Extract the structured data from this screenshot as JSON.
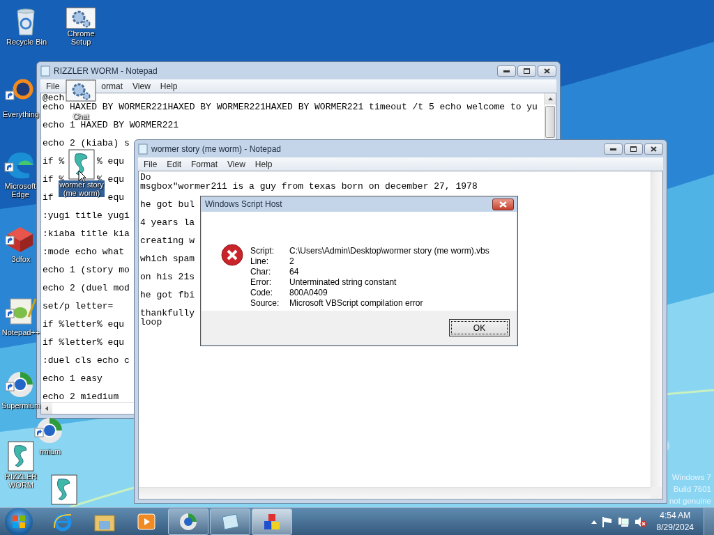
{
  "desktop_icons": [
    {
      "label": "Recycle Bin",
      "kind": "recycle-bin",
      "shortcut": false,
      "selected": false
    },
    {
      "label": "Chrome Setup",
      "kind": "gear",
      "shortcut": false,
      "selected": false
    },
    {
      "label": "Everything",
      "kind": "ring",
      "shortcut": true,
      "selected": false
    },
    {
      "label": "Chat",
      "kind": "gear",
      "shortcut": false,
      "selected": false
    },
    {
      "label": "Microsoft Edge",
      "kind": "edge",
      "shortcut": true,
      "selected": false
    },
    {
      "label": "wormer story (me worm)",
      "kind": "script",
      "shortcut": false,
      "selected": true
    },
    {
      "label": "3dfox",
      "kind": "cube",
      "shortcut": true,
      "selected": false
    },
    {
      "label": "Notepad++",
      "kind": "notepad",
      "shortcut": true,
      "selected": false
    },
    {
      "label": "Supermium",
      "kind": "globe",
      "shortcut": true,
      "selected": false
    },
    {
      "label": "rmium",
      "kind": "globe",
      "shortcut": true,
      "selected": false
    },
    {
      "label": "RIZZLER WORM",
      "kind": "script",
      "shortcut": false,
      "selected": false
    },
    {
      "kind": "script",
      "shortcut": false,
      "selected": false
    }
  ],
  "windows": [
    {
      "title": "RIZZLER WORM - Notepad",
      "menu": [
        "File",
        "ormat",
        "View",
        "Help"
      ],
      "paragraphs": [
        [
          "@ech",
          "echo HAXED BY WORMER221HAXED BY WORMER221HAXED BY WORMER221 timeout /t 5 echo welcome to yu"
        ],
        [
          "echo 1 HAXED BY WORMER221"
        ],
        [
          "echo 2 (kiaba) s"
        ],
        [
          [
            "if %",
            "% equ"
          ]
        ],
        [
          [
            "if %",
            "% equ"
          ]
        ],
        [
          [
            "if",
            "equ"
          ]
        ],
        [
          ":yugi title yugi"
        ],
        [
          ":kiaba title kia"
        ],
        [
          ":mode echo what"
        ],
        [
          "echo 1 (story mo"
        ],
        [
          "echo 2 (duel mod"
        ],
        [
          "set/p letter="
        ],
        [
          "if %letter% equ"
        ],
        [
          "if %letter% equ"
        ],
        [
          ":duel cls echo c"
        ],
        [
          "echo 1 easy"
        ],
        [
          "echo 2 miedium"
        ]
      ]
    },
    {
      "title": "wormer story (me worm) - Notepad",
      "menu": [
        "File",
        "Edit",
        "Format",
        "View",
        "Help"
      ],
      "paragraphs": [
        [
          "Do",
          "msgbox\"wormer211 is a guy from texas born on december 27, 1978"
        ],
        [
          "he got bul"
        ],
        [
          "4 years la"
        ],
        [
          "creating w"
        ],
        [
          "which spam"
        ],
        [
          "on his 21s"
        ],
        [
          "he got fbi"
        ],
        [
          "thankfully",
          "loop"
        ]
      ]
    }
  ],
  "dialog": {
    "title": "Windows Script Host",
    "rows": [
      {
        "label": "Script:",
        "value": "C:\\Users\\Admin\\Desktop\\wormer story (me worm).vbs"
      },
      {
        "label": "Line:",
        "value": "2"
      },
      {
        "label": "Char:",
        "value": "64"
      },
      {
        "label": "Error:",
        "value": "Unterminated string constant"
      },
      {
        "label": "Code:",
        "value": "800A0409"
      },
      {
        "label": "Source:",
        "value": "Microsoft VBScript compilation error"
      }
    ],
    "button": "OK"
  },
  "watermark": [
    "Windows 7",
    "Build 7601",
    "not genuine"
  ],
  "taskbar": {
    "apps": [
      {
        "kind": "ie",
        "open": false,
        "selected": false
      },
      {
        "kind": "folder",
        "open": false,
        "selected": false
      },
      {
        "kind": "media",
        "open": false,
        "selected": false
      },
      {
        "kind": "globe",
        "open": true,
        "selected": false
      },
      {
        "kind": "notepad",
        "open": true,
        "selected": false
      },
      {
        "kind": "cube",
        "open": true,
        "selected": true
      }
    ],
    "clock": {
      "time": "4:54 AM",
      "date": "8/29/2024"
    }
  }
}
